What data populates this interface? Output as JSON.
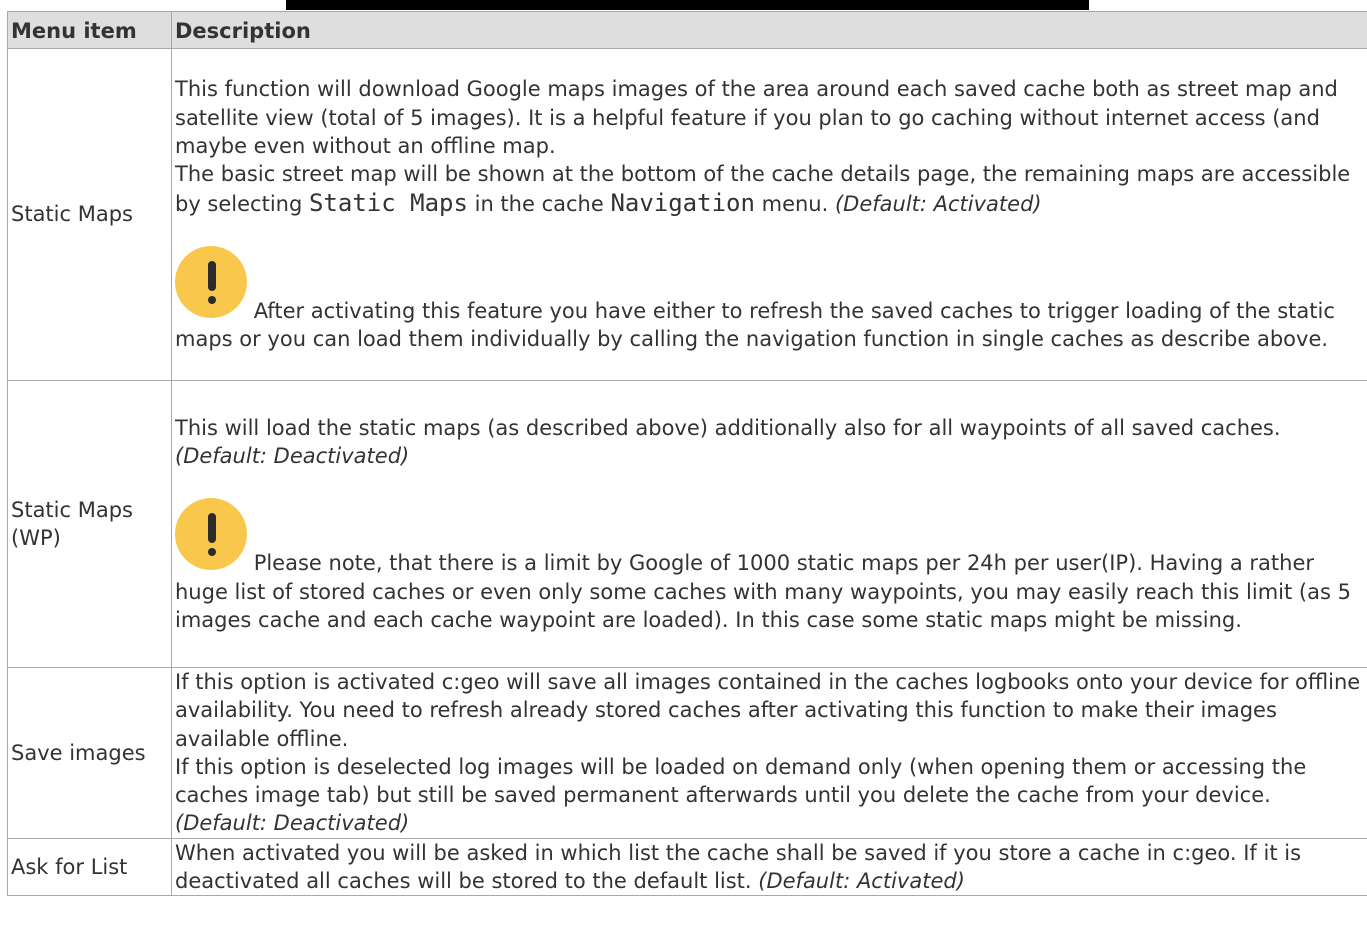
{
  "header": {
    "col_menu": "Menu item",
    "col_desc": "Description"
  },
  "rows": [
    {
      "name": "Static Maps",
      "p1_a": "This function will download Google maps images of the area around each saved cache both as street map and satellite view (total of 5 images). It is a helpful feature if you plan to go caching without internet access (and maybe even without an offline map.",
      "p1_b": "The basic street map will be shown at the bottom of the cache details page, the remaining maps are accessible by selecting ",
      "p1_code1": "Static Maps",
      "p1_c": " in the cache ",
      "p1_code2": "Navigation",
      "p1_d": " menu. ",
      "p1_default": "(Default: Activated)",
      "note": "After activating this feature you have either to refresh the saved caches to trigger loading of the static maps or you can load them individually by calling the navigation function in single caches as describe above."
    },
    {
      "name_line1": "Static Maps",
      "name_line2": "(WP)",
      "p1": "This will load the static maps (as described above) additionally also for all waypoints of all saved caches. ",
      "p1_default": "(Default: Deactivated)",
      "note": "Please note, that there is a limit by Google of 1000 static maps per 24h per user(IP). Having a rather huge list of stored caches or even only some caches with many waypoints, you may easily reach this limit (as 5 images cache and each cache waypoint are loaded). In this case some static maps might be missing."
    },
    {
      "name": "Save images",
      "p1": "If this option is activated c:geo will save all images contained in the caches logbooks onto your device for offline availability. You need to refresh already stored caches after activating this function to make their images available offline.",
      "p2": "If this option is deselected log images will be loaded on demand only (when opening them or accessing the caches image tab) but still be saved permanent afterwards until you delete the cache from your device. ",
      "p2_default": "(Default: Deactivated)"
    },
    {
      "name": "Ask for List",
      "p1": "When activated you will be asked in which list the cache shall be saved if you store a cache in c:geo. If it is deactivated all caches will be stored to the default list. ",
      "p1_default": "(Default: Activated)"
    }
  ],
  "icons": {
    "warning": "warning-icon",
    "warning_color": "#f9c74b"
  }
}
